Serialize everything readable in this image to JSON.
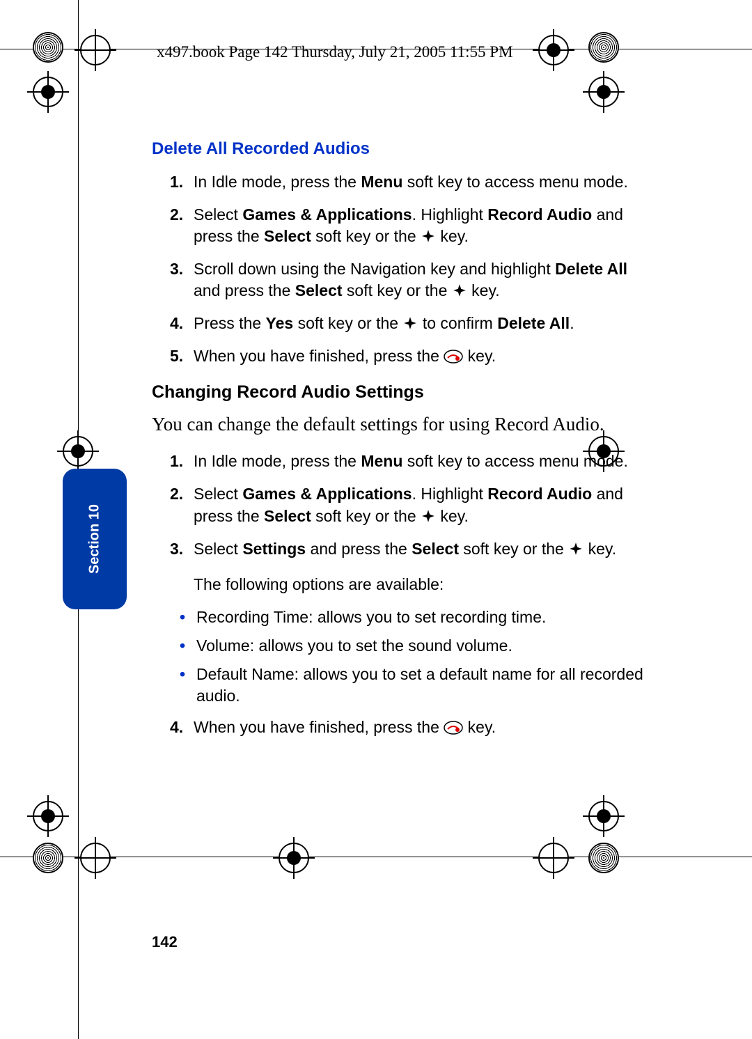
{
  "header": "x497.book  Page 142  Thursday, July 21, 2005  11:55 PM",
  "section_tab": "Section 10",
  "page_number": "142",
  "h1": "Delete All Recorded Audios",
  "steps_a": {
    "s1a": "In Idle mode, press the ",
    "s1b": "Menu",
    "s1c": " soft key to access menu mode.",
    "s2a": "Select ",
    "s2b": "Games & Applications",
    "s2c": ". Highlight ",
    "s2d": "Record Audio",
    "s2e": " and press the ",
    "s2f": "Select",
    "s2g": " soft key or the ",
    "s2h": " key.",
    "s3a": "Scroll down using the Navigation key and highlight ",
    "s3b": "Delete All",
    "s3c": " and press the ",
    "s3d": "Select",
    "s3e": " soft key or the ",
    "s3f": " key.",
    "s4a": "Press the ",
    "s4b": "Yes",
    "s4c": " soft key or the ",
    "s4d": " to confirm ",
    "s4e": "Delete All",
    "s4f": ".",
    "s5a": "When you have finished, press the ",
    "s5b": " key."
  },
  "h2": "Changing Record Audio Settings",
  "intro": "You can change the default settings for using Record Audio.",
  "steps_b": {
    "s1a": " In Idle mode, press the ",
    "s1b": "Menu",
    "s1c": " soft key to access menu mode.",
    "s2a": "Select ",
    "s2b": "Games & Applications",
    "s2c": ". Highlight ",
    "s2d": "Record Audio",
    "s2e": " and press the ",
    "s2f": "Select",
    "s2g": " soft key or the ",
    "s2h": " key.",
    "s3a": "Select ",
    "s3b": "Settings",
    "s3c": " and press the ",
    "s3d": "Select",
    "s3e": " soft key or the ",
    "s3f": " key."
  },
  "note": "The following options are available:",
  "bullets": {
    "b1": "Recording Time: allows you to set recording time.",
    "b2": "Volume: allows you to set the sound volume.",
    "b3": "Default Name: allows you to set a default name for all recorded audio."
  },
  "step_b4a": "When you have finished, press the ",
  "step_b4b": " key."
}
